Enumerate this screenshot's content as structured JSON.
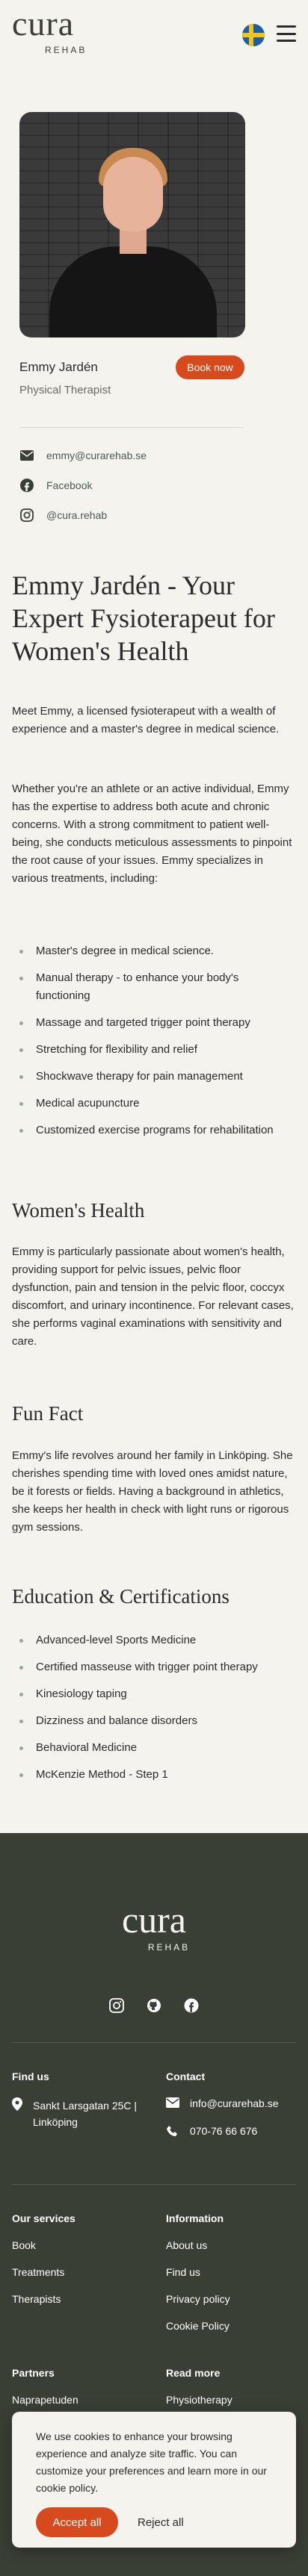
{
  "header": {
    "logo_word": "cura",
    "logo_sub": "REHAB",
    "flag_icon": "swedish-flag-icon",
    "menu_icon": "hamburger-menu-icon"
  },
  "profile": {
    "name": "Emmy Jardén",
    "role": "Physical Therapist",
    "book_label": "Book now",
    "email": "emmy@curarehab.se",
    "facebook": "Facebook",
    "instagram": "@cura.rehab"
  },
  "article": {
    "title": "Emmy Jardén - Your Expert Fysioterapeut for Women's Health",
    "intro": "Meet Emmy, a licensed fysioterapeut with a wealth of experience and a master's degree in medical science.",
    "para2": "Whether you're an athlete or an active individual, Emmy has the expertise to address both acute and chronic concerns. With a strong commitment to patient well-being, she conducts meticulous assessments to pinpoint the root cause of your issues. Emmy specializes in various treatments, including:",
    "treatments": [
      "Master's degree in medical science.",
      "Manual therapy - to enhance your body's functioning",
      "Massage and targeted trigger point therapy",
      "Stretching for flexibility and relief",
      "Shockwave therapy for pain management",
      "Medical acupuncture",
      "Customized exercise programs for rehabilitation"
    ],
    "womens_title": "Women's Health",
    "womens_text": "Emmy is particularly passionate about women's health, providing support for pelvic issues, pelvic floor dysfunction, pain and tension in the pelvic floor, coccyx discomfort, and urinary incontinence. For relevant cases, she performs vaginal examinations with sensitivity and care.",
    "fun_title": "Fun Fact",
    "fun_text": "Emmy's life revolves around her family in Linköping. She cherishes spending time with loved ones amidst nature, be it forests or fields. Having a background in athletics, she keeps her health in check with light runs or rigorous gym sessions.",
    "edu_title": "Education & Certifications",
    "education": [
      "Advanced-level Sports Medicine",
      "Certified masseuse with trigger point therapy",
      "Kinesiology taping",
      "Dizziness and balance disorders",
      "Behavioral Medicine",
      "McKenzie Method - Step 1"
    ]
  },
  "footer": {
    "logo_word": "cura",
    "logo_sub": "REHAB",
    "find_us_title": "Find us",
    "address": "Sankt Larsgatan 25C | Linköping",
    "contact_title": "Contact",
    "contact_email": "info@curarehab.se",
    "contact_phone": "070-76 66 676",
    "services_title": "Our services",
    "services": [
      "Book",
      "Treatments",
      "Therapists"
    ],
    "info_title": "Information",
    "info": [
      "About us",
      "Find us",
      "Privacy policy",
      "Cookie Policy"
    ],
    "partners_title": "Partners",
    "partners": [
      "Naprapetuden"
    ],
    "read_more_title": "Read more",
    "read_more": [
      "Physiotherapy"
    ]
  },
  "cookie": {
    "text": "We use cookies to enhance your browsing experience and analyze site traffic. You can customize your preferences and learn more in our cookie policy.",
    "accept_label": "Accept all",
    "reject_label": "Reject all"
  }
}
